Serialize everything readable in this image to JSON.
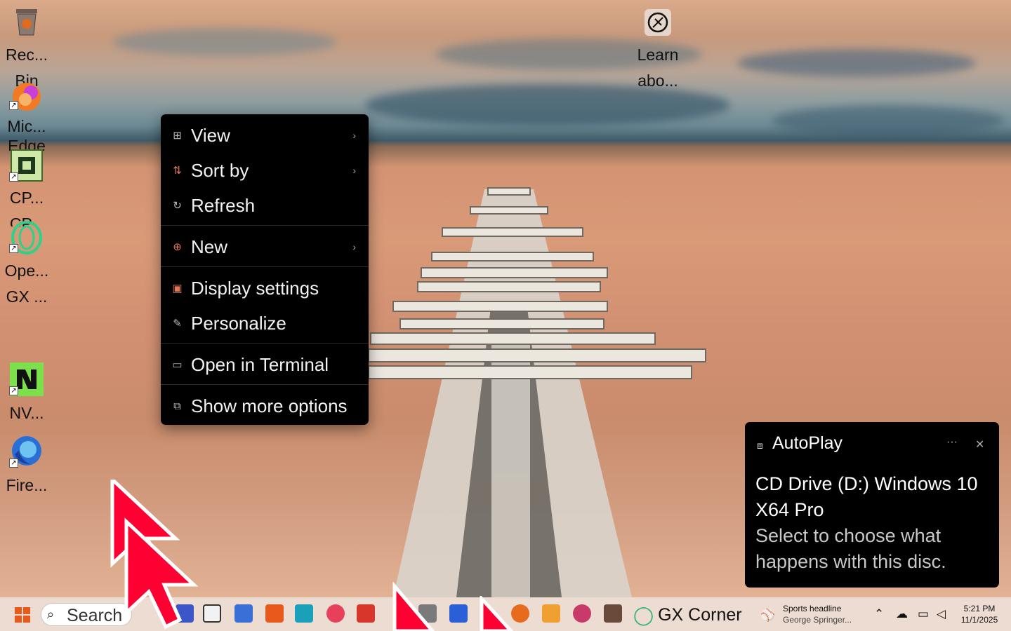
{
  "desktop": {
    "icons": [
      {
        "label": "Rec... Bin",
        "line1": "Rec...",
        "line2": "Bin",
        "icon": "recycle-bin-icon"
      },
      {
        "label": "Mic... Edge",
        "line1": "Mic...",
        "line2": "Edge",
        "icon": "edge-icon"
      },
      {
        "label": "CP... CP...",
        "line1": "CP...",
        "line2": "CP...",
        "icon": "cpu-z-icon"
      },
      {
        "label": "Ope... GX ...",
        "line1": "Ope...",
        "line2": "GX ...",
        "icon": "opera-gx-icon"
      },
      {
        "label": "NV...",
        "line1": "NV...",
        "icon": "nvidia-icon"
      },
      {
        "label": "Fire...",
        "line1": "Fire...",
        "icon": "firefox-icon"
      },
      {
        "label": "Learn abo...",
        "line1": "Learn",
        "line2": "abo...",
        "icon": "learn-about-icon"
      }
    ]
  },
  "context_menu": {
    "items": [
      {
        "label": "View",
        "icon": "grid-icon",
        "submenu": true
      },
      {
        "label": "Sort by",
        "icon": "sort-icon",
        "submenu": true
      },
      {
        "label": "Refresh",
        "icon": "refresh-icon",
        "submenu": false
      },
      {
        "label": "New",
        "icon": "plus-circle-icon",
        "submenu": true
      },
      {
        "label": "Display settings",
        "icon": "display-icon",
        "submenu": false
      },
      {
        "label": "Personalize",
        "icon": "brush-icon",
        "submenu": false
      },
      {
        "label": "Open in Terminal",
        "icon": "terminal-icon",
        "submenu": false
      },
      {
        "label": "Show more options",
        "icon": "more-options-icon",
        "submenu": false
      }
    ]
  },
  "autoplay": {
    "title": "AutoPlay",
    "heading": "CD Drive (D:) Windows 10 X64 Pro",
    "body": "Select to choose what happens with this disc.",
    "more": "···",
    "close": "✕"
  },
  "taskbar": {
    "search_label": "Search",
    "gx_corner_label": "GX Corner",
    "news_title": "Sports headline",
    "news_subtitle": "George Springer...",
    "clock_time": "5:21 PM",
    "clock_date": "11/1/2025"
  },
  "colors": {
    "menu_bg": "#000000",
    "taskbar_bg": "#ecdcd2",
    "cursor_red": "#ff0033"
  }
}
